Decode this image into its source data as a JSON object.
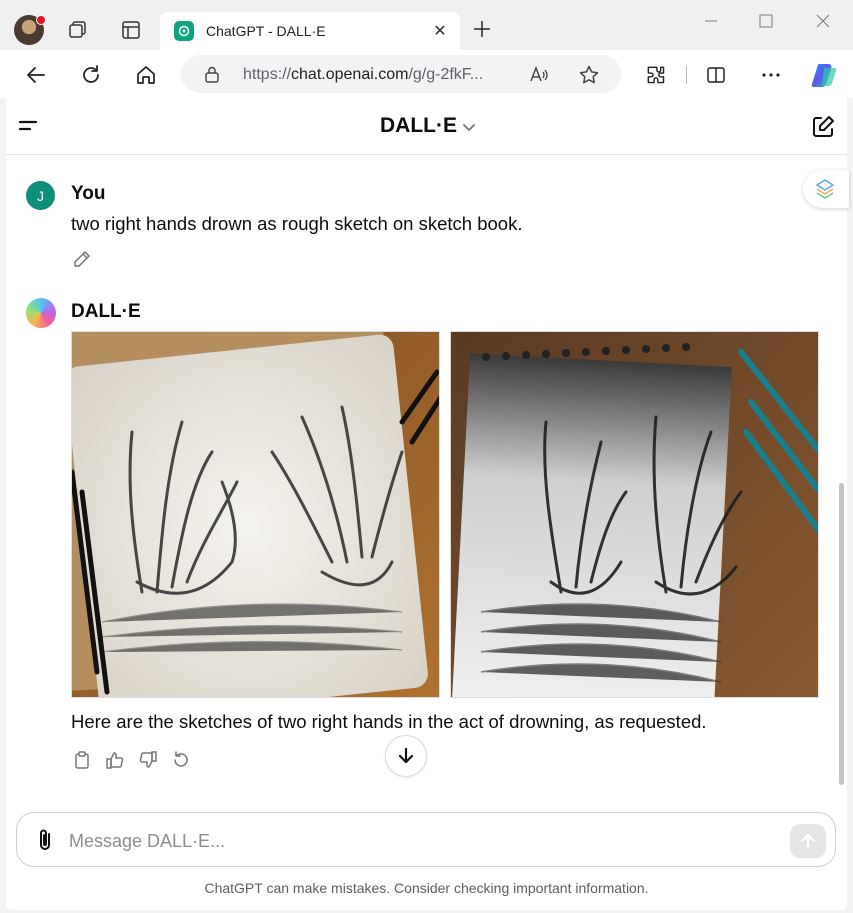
{
  "browser": {
    "tab_title": "ChatGPT - DALL·E",
    "url_prefix": "https://",
    "url_domain": "chat.openai.com",
    "url_path": "/g/g-2fkF...",
    "accent": "#10a37f"
  },
  "header": {
    "model_name": "DALL·E"
  },
  "conversation": {
    "user": {
      "avatar_letter": "J",
      "author": "You",
      "text": "two right hands drown as rough sketch on sketch book."
    },
    "assistant": {
      "author": "DALL·E",
      "text": "Here are the sketches of two right hands in the act of drowning, as requested."
    }
  },
  "composer": {
    "placeholder": "Message DALL·E..."
  },
  "footer": {
    "disclaimer": "ChatGPT can make mistakes. Consider checking important information."
  }
}
